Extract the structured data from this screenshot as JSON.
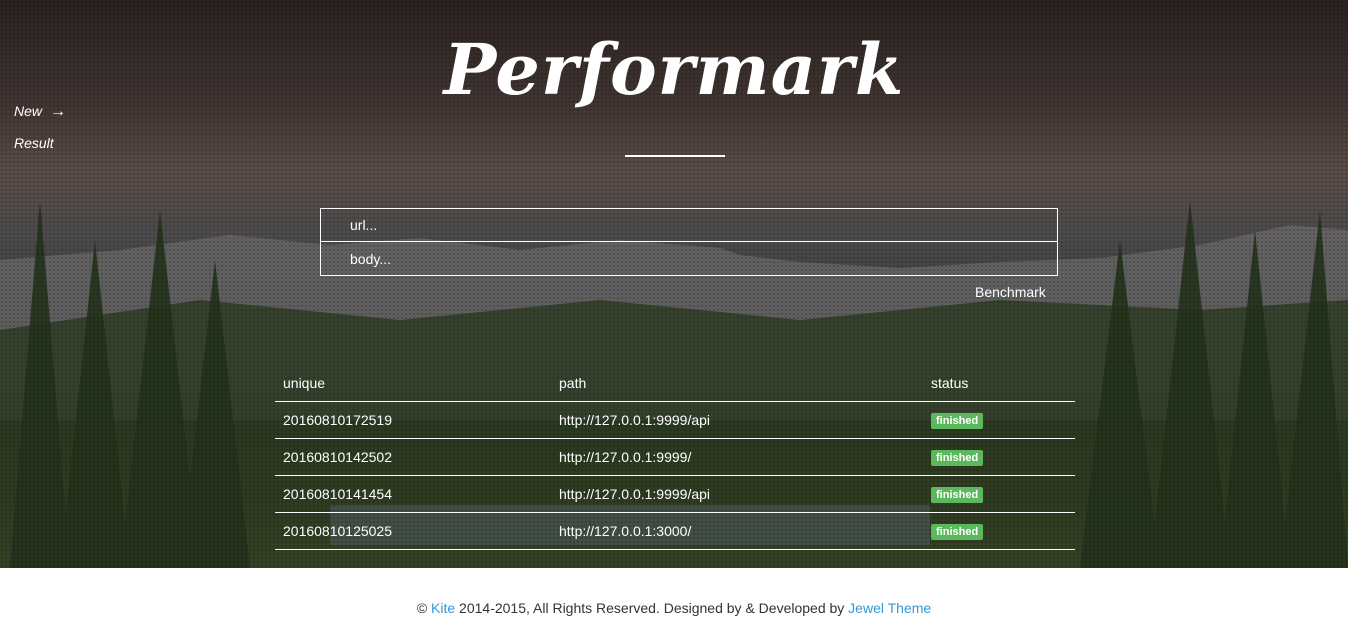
{
  "nav": {
    "new_label": "New",
    "new_arrow": "→",
    "result_label": "Result"
  },
  "header": {
    "title": "Performark"
  },
  "form": {
    "url_placeholder": "url...",
    "body_placeholder": "body...",
    "submit_label": "Benchmark"
  },
  "table": {
    "headers": [
      "unique",
      "path",
      "status"
    ],
    "rows": [
      {
        "unique": "20160810172519",
        "path": "http://127.0.0.1:9999/api",
        "status": "finished"
      },
      {
        "unique": "20160810142502",
        "path": "http://127.0.0.1:9999/",
        "status": "finished"
      },
      {
        "unique": "20160810141454",
        "path": "http://127.0.0.1:9999/api",
        "status": "finished"
      },
      {
        "unique": "20160810125025",
        "path": "http://127.0.0.1:3000/",
        "status": "finished"
      }
    ]
  },
  "footer": {
    "copyright_symbol": "©",
    "brand_link": "Kite",
    "middle_text": "2014-2015, All Rights Reserved. Designed by & Developed by",
    "theme_link": "Jewel Theme"
  },
  "colors": {
    "status_badge": "#5cb85c",
    "link": "#3498db"
  }
}
